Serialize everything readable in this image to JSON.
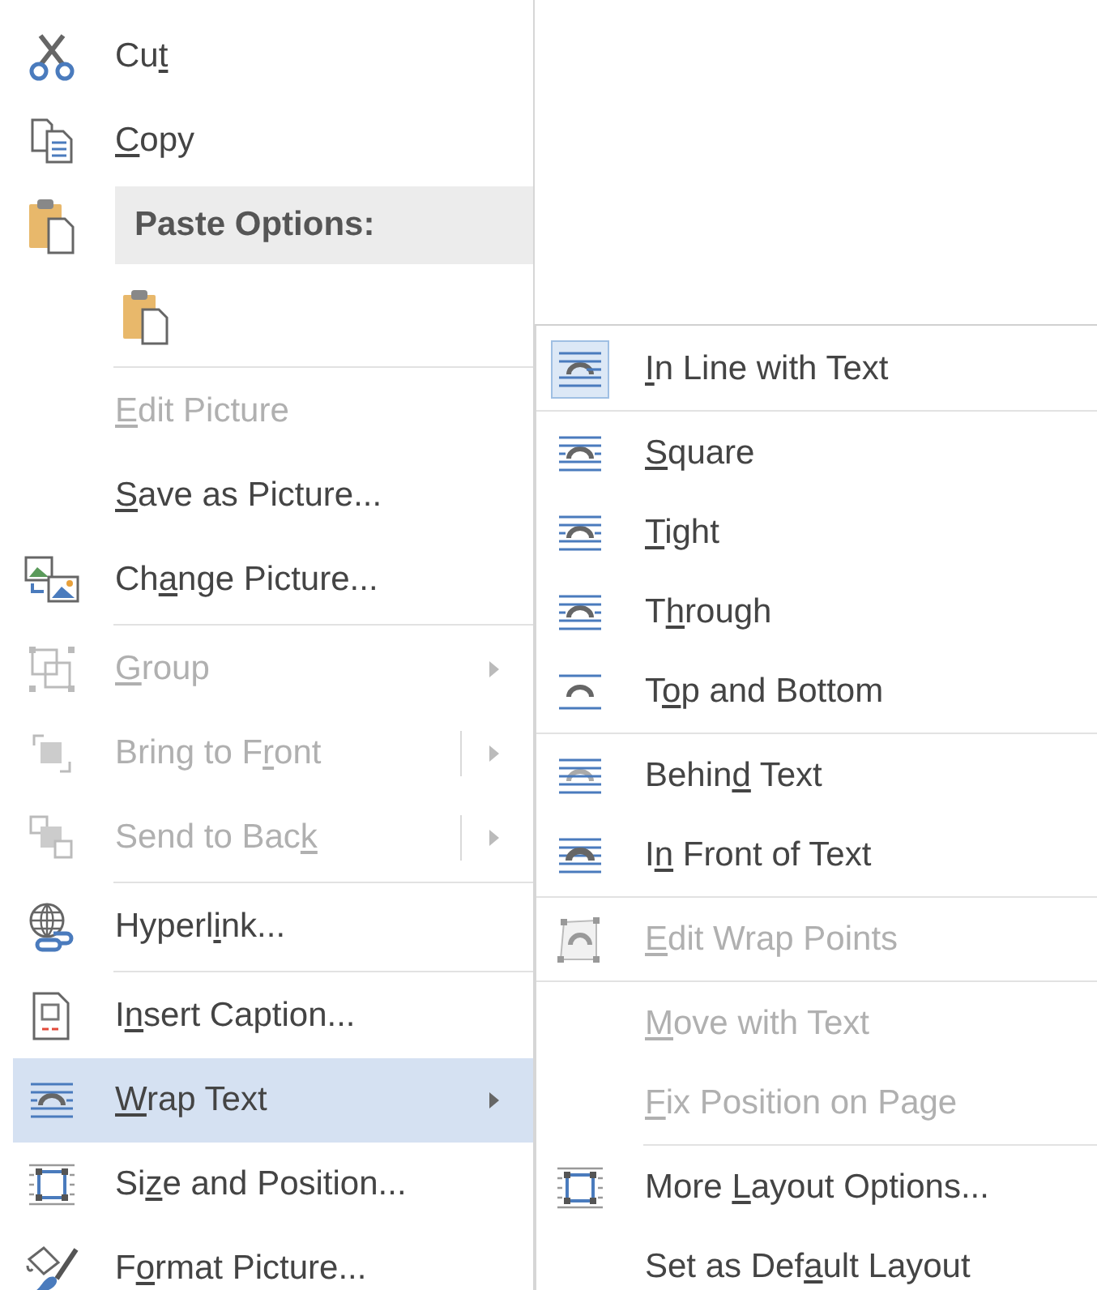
{
  "context_menu": {
    "items": [
      {
        "kind": "command",
        "label": {
          "before": "Cu",
          "key": "t"
        },
        "disabled": false,
        "selected": false
      },
      {
        "kind": "command",
        "label": {
          "key": "C",
          "after": "opy"
        },
        "disabled": false,
        "selected": false
      },
      {
        "kind": "header",
        "label": "Paste Options:"
      },
      {
        "kind": "paste_buttons"
      },
      {
        "kind": "separator"
      },
      {
        "kind": "command",
        "label": {
          "key": "E",
          "after": "dit Picture"
        },
        "disabled": true,
        "selected": false
      },
      {
        "kind": "command",
        "label": {
          "key": "S",
          "after": "ave as Picture..."
        },
        "disabled": false,
        "selected": false
      },
      {
        "kind": "command",
        "label": {
          "before": "Ch",
          "key": "a",
          "after": "nge Picture..."
        },
        "disabled": false,
        "selected": false
      },
      {
        "kind": "separator"
      },
      {
        "kind": "command",
        "label": {
          "key": "G",
          "after": "roup"
        },
        "disabled": true,
        "selected": false,
        "has_submenu": true,
        "split": false
      },
      {
        "kind": "command",
        "label": {
          "before": "Bring to F",
          "key": "r",
          "after": "ont"
        },
        "disabled": true,
        "selected": false,
        "has_submenu": true,
        "split": true
      },
      {
        "kind": "command",
        "label": {
          "before": "Send to Bac",
          "key": "k"
        },
        "disabled": true,
        "selected": false,
        "has_submenu": true,
        "split": true
      },
      {
        "kind": "separator"
      },
      {
        "kind": "command",
        "label": {
          "before": "Hyperl",
          "key": "i",
          "after": "nk..."
        },
        "disabled": false,
        "selected": false
      },
      {
        "kind": "separator"
      },
      {
        "kind": "command",
        "label": {
          "before": "I",
          "key": "n",
          "after": "sert Caption..."
        },
        "disabled": false,
        "selected": false
      },
      {
        "kind": "command",
        "label": {
          "key": "W",
          "after": "rap Text"
        },
        "disabled": false,
        "selected": true,
        "has_submenu": true,
        "split": false
      },
      {
        "kind": "command",
        "label": {
          "before": "Si",
          "key": "z",
          "after": "e and Position..."
        },
        "disabled": false,
        "selected": false
      },
      {
        "kind": "command",
        "label": {
          "before": "F",
          "key": "o",
          "after": "rmat Picture..."
        },
        "disabled": false,
        "selected": false
      }
    ]
  },
  "wrap_text_submenu": {
    "items": [
      {
        "kind": "command",
        "label": {
          "key": "I",
          "after": "n Line with Text"
        },
        "disabled": false,
        "checked": true
      },
      {
        "kind": "separator",
        "inset": false
      },
      {
        "kind": "command",
        "label": {
          "key": "S",
          "after": "quare"
        },
        "disabled": false,
        "checked": false
      },
      {
        "kind": "command",
        "label": {
          "key": "T",
          "after": "ight"
        },
        "disabled": false,
        "checked": false
      },
      {
        "kind": "command",
        "label": {
          "before": "T",
          "key": "h",
          "after": "rough"
        },
        "disabled": false,
        "checked": false
      },
      {
        "kind": "command",
        "label": {
          "before": "T",
          "key": "o",
          "after": "p and Bottom"
        },
        "disabled": false,
        "checked": false
      },
      {
        "kind": "separator",
        "inset": false
      },
      {
        "kind": "command",
        "label": {
          "before": "Behin",
          "key": "d",
          "after": " Text"
        },
        "disabled": false,
        "checked": false
      },
      {
        "kind": "command",
        "label": {
          "before": "I",
          "key": "n",
          "after": " Front of Text"
        },
        "disabled": false,
        "checked": false
      },
      {
        "kind": "separator",
        "inset": false
      },
      {
        "kind": "command",
        "label": {
          "key": "E",
          "after": "dit Wrap Points"
        },
        "disabled": true
      },
      {
        "kind": "separator",
        "inset": false
      },
      {
        "kind": "command",
        "label": {
          "key": "M",
          "after": "ove with Text"
        },
        "disabled": true
      },
      {
        "kind": "command",
        "label": {
          "key": "F",
          "after": "ix Position on Page"
        },
        "disabled": true
      },
      {
        "kind": "separator",
        "inset": true
      },
      {
        "kind": "command",
        "label": {
          "before": "More ",
          "key": "L",
          "after": "ayout Options..."
        },
        "disabled": false
      },
      {
        "kind": "command",
        "label": {
          "before": "Set as Def",
          "key": "a",
          "after": "ult Layout"
        },
        "disabled": false
      }
    ]
  }
}
